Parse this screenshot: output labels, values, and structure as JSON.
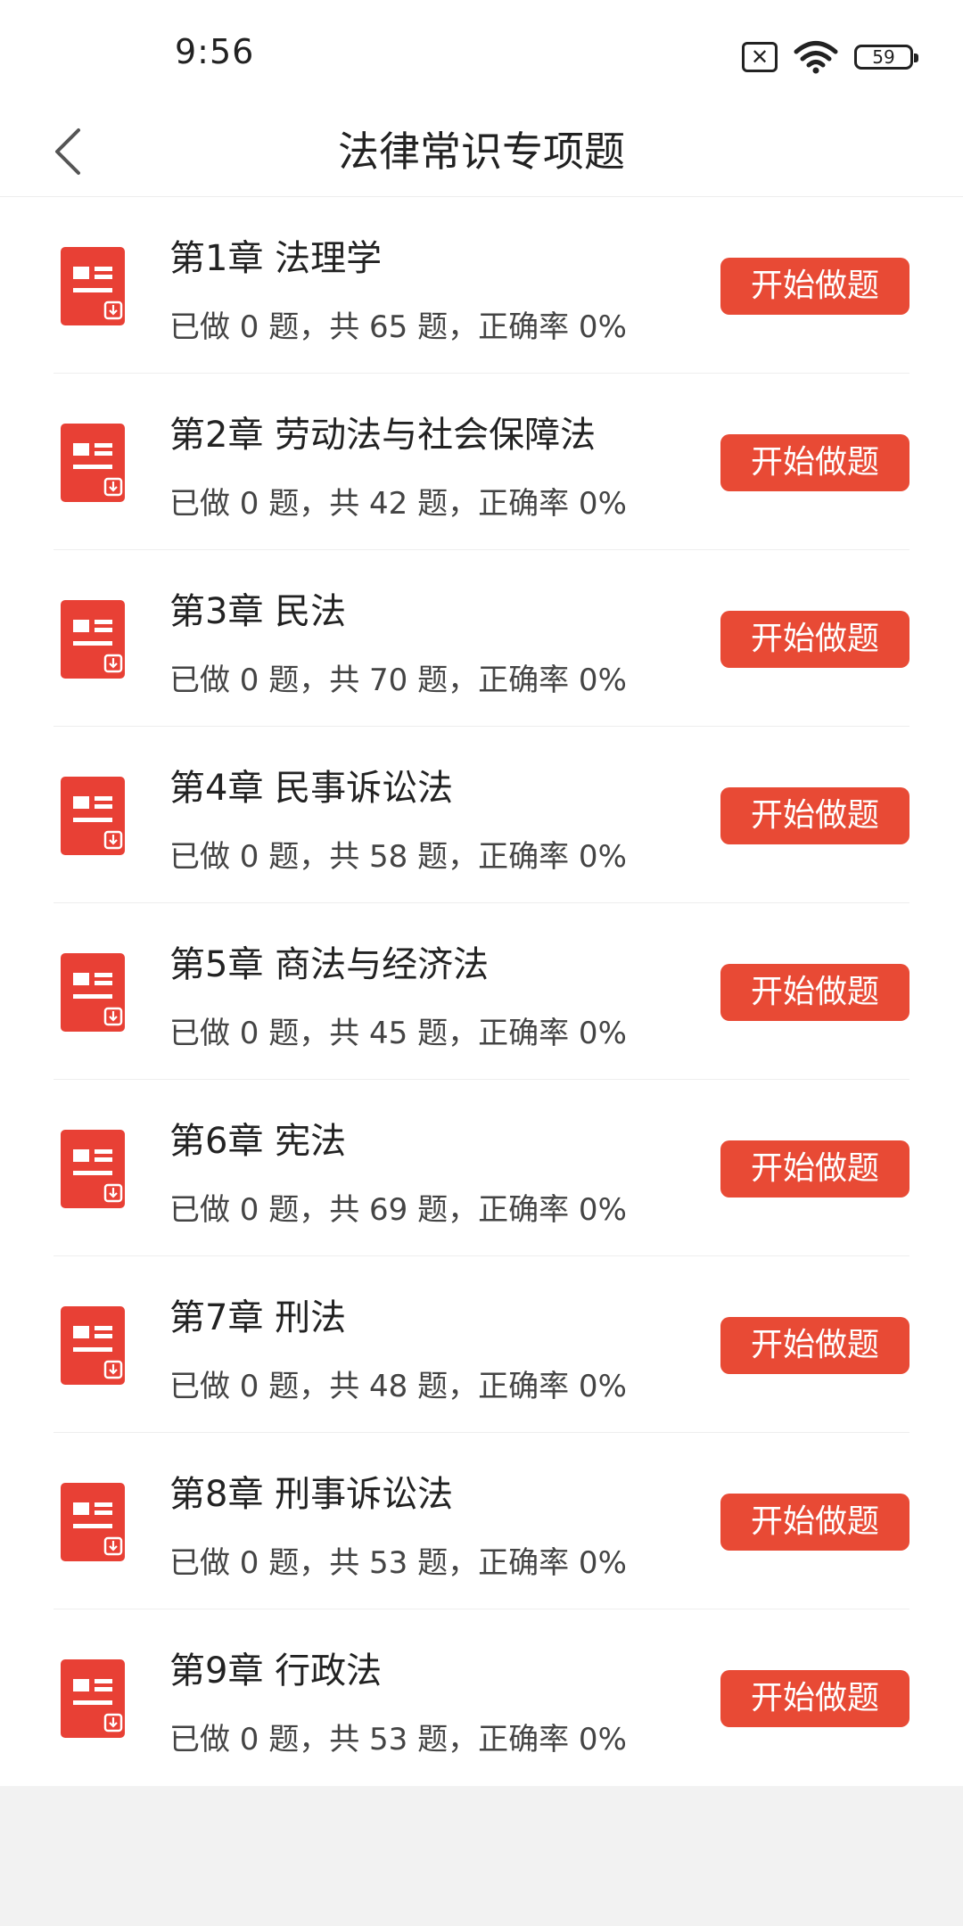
{
  "status_bar": {
    "time": "9:56",
    "battery_level": "59",
    "icons": [
      "sim-no-signal-icon",
      "wifi-icon",
      "battery-icon"
    ]
  },
  "header": {
    "title": "法律常识专项题",
    "back_icon": "chevron-left-icon"
  },
  "colors": {
    "accent": "#e84a35",
    "icon_red": "#e84035"
  },
  "chapters": [
    {
      "title": "第1章 法理学",
      "stats": "已做 0 题，共 65 题，正确率 0%",
      "button_label": "开始做题"
    },
    {
      "title": "第2章 劳动法与社会保障法",
      "stats": "已做 0 题，共 42 题，正确率 0%",
      "button_label": "开始做题"
    },
    {
      "title": "第3章 民法",
      "stats": "已做 0 题，共 70 题，正确率 0%",
      "button_label": "开始做题"
    },
    {
      "title": "第4章 民事诉讼法",
      "stats": "已做 0 题，共 58 题，正确率 0%",
      "button_label": "开始做题"
    },
    {
      "title": "第5章 商法与经济法",
      "stats": "已做 0 题，共 45 题，正确率 0%",
      "button_label": "开始做题"
    },
    {
      "title": "第6章 宪法",
      "stats": "已做 0 题，共 69 题，正确率 0%",
      "button_label": "开始做题"
    },
    {
      "title": "第7章 刑法",
      "stats": "已做 0 题，共 48 题，正确率 0%",
      "button_label": "开始做题"
    },
    {
      "title": "第8章 刑事诉讼法",
      "stats": "已做 0 题，共 53 题，正确率 0%",
      "button_label": "开始做题"
    },
    {
      "title": "第9章 行政法",
      "stats": "已做 0 题，共 53 题，正确率 0%",
      "button_label": "开始做题"
    }
  ]
}
